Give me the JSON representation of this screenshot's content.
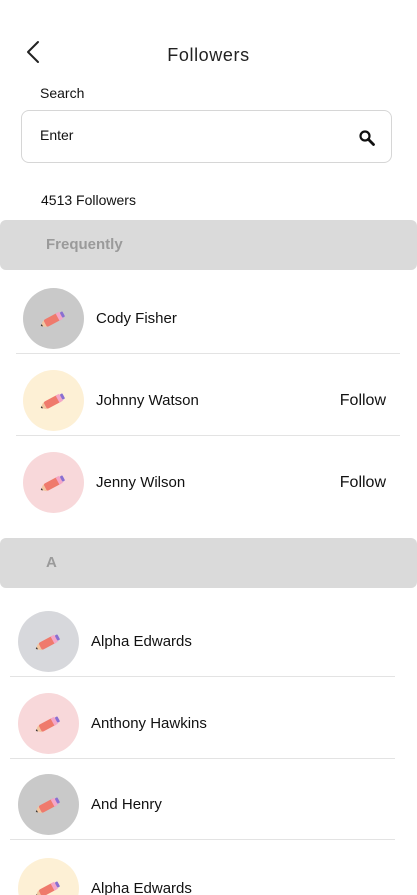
{
  "header": {
    "title": "Followers",
    "back_icon": "chevron-left-icon"
  },
  "search": {
    "label": "Search",
    "placeholder": "Enter",
    "value": "",
    "icon": "search-icon"
  },
  "followers_count": "4513 Followers",
  "sections": [
    {
      "title": "Frequently",
      "items": [
        {
          "name": "Cody Fisher",
          "avatar_bg": "#c9c9c9",
          "action": ""
        },
        {
          "name": "Johnny Watson",
          "avatar_bg": "#fdf0d5",
          "action": "Follow"
        },
        {
          "name": "Jenny Wilson",
          "avatar_bg": "#f8d8da",
          "action": "Follow"
        }
      ]
    },
    {
      "title": "A",
      "items": [
        {
          "name": "Alpha Edwards",
          "avatar_bg": "#d7d8dc",
          "action": ""
        },
        {
          "name": "Anthony Hawkins",
          "avatar_bg": "#f8d8da",
          "action": ""
        },
        {
          "name": "And Henry",
          "avatar_bg": "#c9c9c9",
          "action": ""
        },
        {
          "name": "Alpha Edwards",
          "avatar_bg": "#fdf0d5",
          "action": ""
        }
      ]
    }
  ],
  "colors": {
    "section_bg": "#dadada",
    "section_text": "#9a9a9a",
    "divider": "#e3e3e3"
  },
  "avatar_icon": "pencil-icon"
}
